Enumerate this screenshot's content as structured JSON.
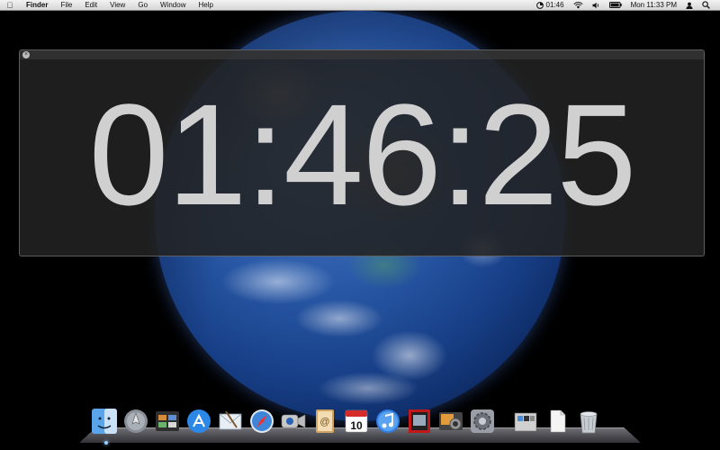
{
  "menubar": {
    "apple_icon": "apple-logo-icon",
    "items": [
      "Finder",
      "File",
      "Edit",
      "View",
      "Go",
      "Window",
      "Help"
    ],
    "clock_status": "01:46",
    "datetime": "Mon 11:33 PM"
  },
  "clock_window": {
    "time": "01:46:25",
    "close_icon": "close-icon"
  },
  "dock": {
    "items": [
      {
        "name": "Finder",
        "icon": "finder-icon"
      },
      {
        "name": "Launchpad",
        "icon": "launchpad-icon"
      },
      {
        "name": "Mission Control",
        "icon": "mission-control-icon"
      },
      {
        "name": "App Store",
        "icon": "app-store-icon"
      },
      {
        "name": "Mail",
        "icon": "mail-icon"
      },
      {
        "name": "Safari",
        "icon": "safari-icon"
      },
      {
        "name": "FaceTime",
        "icon": "facetime-icon"
      },
      {
        "name": "Address Book",
        "icon": "address-book-icon"
      },
      {
        "name": "iCal",
        "icon": "calendar-icon",
        "badge": "10"
      },
      {
        "name": "iTunes",
        "icon": "itunes-icon"
      },
      {
        "name": "Photo Booth",
        "icon": "photo-booth-icon"
      },
      {
        "name": "iPhoto",
        "icon": "iphoto-icon"
      },
      {
        "name": "System Preferences",
        "icon": "system-preferences-icon"
      },
      {
        "name": "Applications",
        "icon": "applications-folder-icon"
      },
      {
        "name": "Documents",
        "icon": "documents-icon"
      },
      {
        "name": "Trash",
        "icon": "trash-icon"
      }
    ]
  }
}
